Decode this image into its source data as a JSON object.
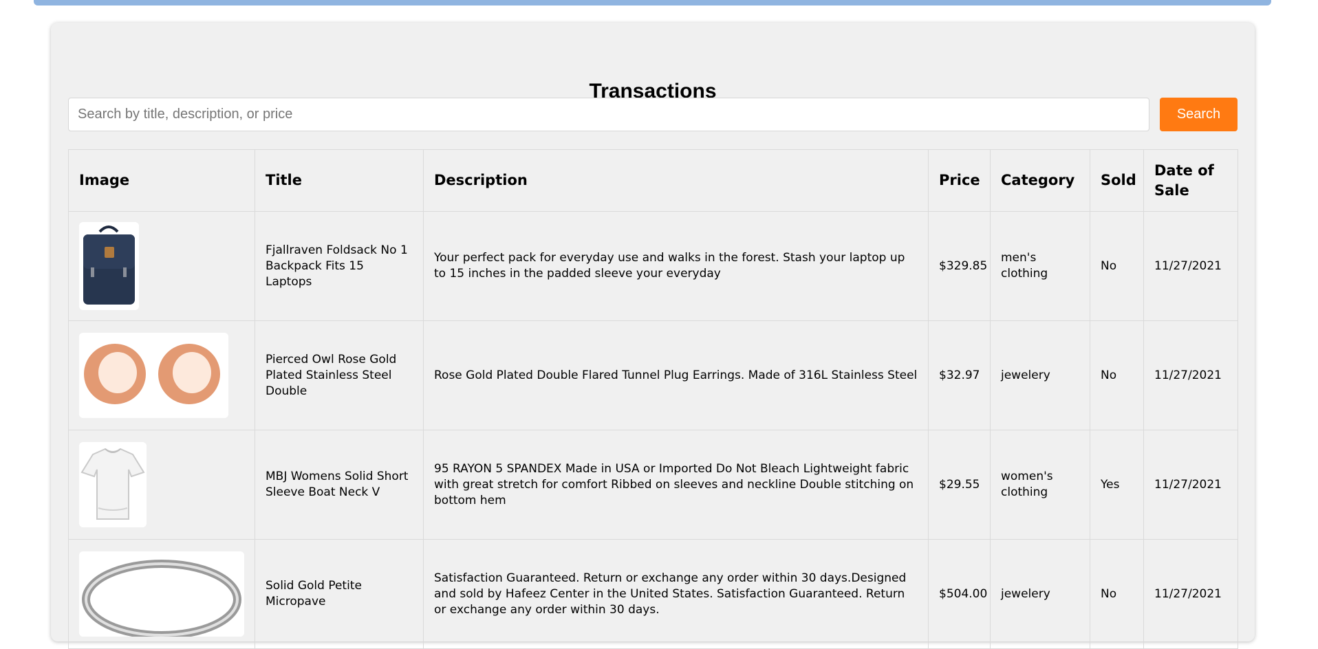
{
  "page": {
    "title": "Transactions"
  },
  "search": {
    "placeholder": "Search by title, description, or price",
    "value": "",
    "button_label": "Search"
  },
  "colors": {
    "accent": "#ff7a12",
    "top_bar": "#8fb4e0",
    "panel_bg": "#f0f0f0"
  },
  "table": {
    "headers": {
      "image": "Image",
      "title": "Title",
      "description": "Description",
      "price": "Price",
      "category": "Category",
      "sold": "Sold",
      "date": "Date of Sale"
    },
    "rows": [
      {
        "image_icon": "backpack-image",
        "title": "Fjallraven Foldsack No 1 Backpack Fits 15 Laptops",
        "description": "Your perfect pack for everyday use and walks in the forest. Stash your laptop up to 15 inches in the padded sleeve your everyday",
        "price": "$329.85",
        "category": "men's clothing",
        "sold": "No",
        "date": "11/27/2021"
      },
      {
        "image_icon": "rose-gold-earrings-image",
        "title": "Pierced Owl Rose Gold Plated Stainless Steel Double",
        "description": "Rose Gold Plated Double Flared Tunnel Plug Earrings. Made of 316L Stainless Steel",
        "price": "$32.97",
        "category": "jewelery",
        "sold": "No",
        "date": "11/27/2021"
      },
      {
        "image_icon": "white-tshirt-image",
        "title": "MBJ Womens Solid Short Sleeve Boat Neck V",
        "description": "95 RAYON 5 SPANDEX Made in USA or Imported Do Not Bleach Lightweight fabric with great stretch for comfort Ribbed on sleeves and neckline Double stitching on bottom hem",
        "price": "$29.55",
        "category": "women's clothing",
        "sold": "Yes",
        "date": "11/27/2021"
      },
      {
        "image_icon": "silver-ring-image",
        "title": "Solid Gold Petite Micropave",
        "description": "Satisfaction Guaranteed. Return or exchange any order within 30 days.Designed and sold by Hafeez Center in the United States. Satisfaction Guaranteed. Return or exchange any order within 30 days.",
        "price": "$504.00",
        "category": "jewelery",
        "sold": "No",
        "date": "11/27/2021"
      }
    ]
  }
}
